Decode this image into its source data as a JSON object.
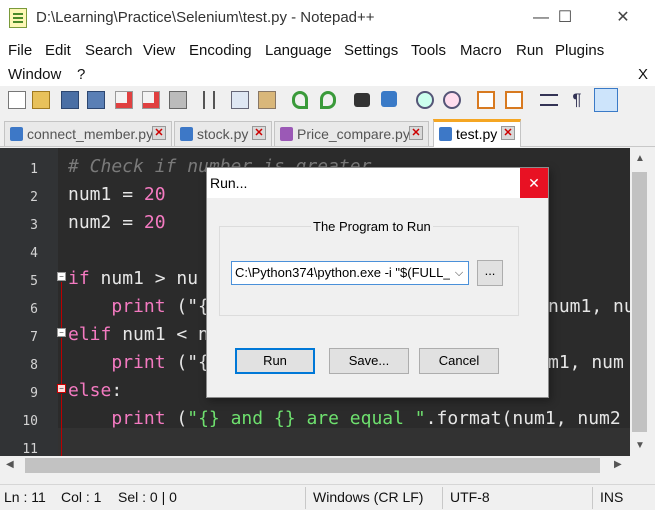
{
  "window": {
    "title": "D:\\Learning\\Practice\\Selenium\\test.py - Notepad++",
    "minimize": "—",
    "maximize": "☐",
    "close": "✕"
  },
  "menu": {
    "items": [
      "File",
      "Edit",
      "Search",
      "View",
      "Encoding",
      "Language",
      "Settings",
      "Tools",
      "Macro",
      "Run",
      "Plugins",
      "Window",
      "?"
    ],
    "close_doc": "X"
  },
  "tabs": [
    {
      "label": "connect_member.py",
      "close": "✕",
      "active": false
    },
    {
      "label": "stock.py",
      "close": "✕",
      "active": false
    },
    {
      "label": "Price_compare.py",
      "close": "✕",
      "active": false
    },
    {
      "label": "test.py",
      "close": "✕",
      "active": true
    }
  ],
  "editor": {
    "line_numbers": [
      "1",
      "2",
      "3",
      "4",
      "5",
      "6",
      "7",
      "8",
      "9",
      "10",
      "11"
    ],
    "line1_comment": "# Check if number is greater",
    "line2_var": "num1",
    "line2_op": " = ",
    "line2_num": "20",
    "line3_var": "num2",
    "line3_op": " = ",
    "line3_num": "20",
    "line5_kw": "if",
    "line5_rest": " num1 > nu",
    "line6_indent": "    ",
    "line6_kw": "print",
    "line6_rest": " (\"{",
    "line6_tail": "num1, nu",
    "line7_kw": "elif",
    "line7_rest": " num1 < n",
    "line8_indent": "    ",
    "line8_kw": "print",
    "line8_rest": " (\"{",
    "line8_tail": "m1, num",
    "line9_kw": "else",
    "line9_rest": ":",
    "line10_indent": "    ",
    "line10_kw": "print",
    "line10_open": " (",
    "line10_str": "\"{} and {} are equal \"",
    "line10_rest": ".format(num1, num2"
  },
  "dialog": {
    "title": "Run...",
    "close": "✕",
    "group_label": "The Program to Run",
    "command_value": "C:\\Python374\\python.exe -i \"$(FULL_",
    "dropdown_arrow": "⌵",
    "browse_label": "...",
    "run_label": "Run",
    "save_label": "Save...",
    "cancel_label": "Cancel"
  },
  "status": {
    "ln": "Ln : 11",
    "col": "Col : 1",
    "sel": "Sel : 0 | 0",
    "eol": "Windows (CR LF)",
    "encoding": "UTF-8",
    "mode": "INS"
  },
  "icons": {
    "toolbar": [
      "new-file-icon",
      "open-file-icon",
      "save-icon",
      "save-all-icon",
      "close-icon",
      "close-all-icon",
      "print-icon",
      "cut-icon",
      "copy-icon",
      "paste-icon",
      "undo-icon",
      "redo-icon",
      "find-icon",
      "replace-icon",
      "zoom-in-icon",
      "zoom-out-icon",
      "sync-v-icon",
      "sync-h-icon",
      "word-wrap-icon",
      "show-all-chars-icon",
      "indent-guide-icon"
    ]
  },
  "colors": {
    "editor_bg": "#2b2b2b",
    "keyword": "#f47ac1",
    "string": "#6ee06e",
    "active_tab_accent": "#f5a623",
    "dialog_close_bg": "#e81123"
  }
}
